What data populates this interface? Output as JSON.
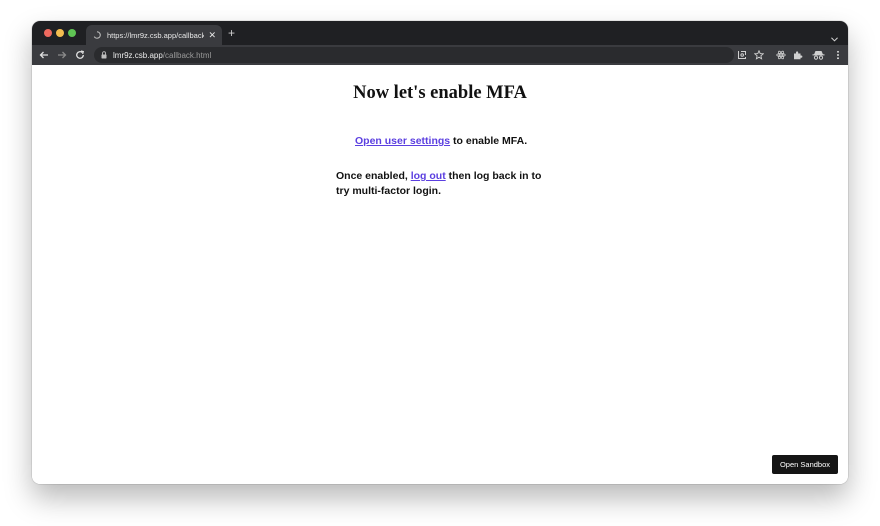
{
  "browser": {
    "tab": {
      "title": "https://lmr9z.csb.app/callback"
    },
    "address_bar": {
      "host": "lmr9z.csb.app",
      "path": "/callback.html"
    }
  },
  "page": {
    "heading": "Now let's enable MFA",
    "settings_link": "Open user settings",
    "settings_suffix": " to enable MFA.",
    "enabled_prefix": "Once enabled, ",
    "logout_link": "log out",
    "enabled_suffix": " then log back in to try multi-factor login."
  },
  "sandbox_button": {
    "label": "Open Sandbox"
  },
  "colors": {
    "link": "#5b3fe0",
    "titlebar": "#1f2023",
    "toolbar": "#3a3b3f",
    "button_bg": "#151515"
  }
}
